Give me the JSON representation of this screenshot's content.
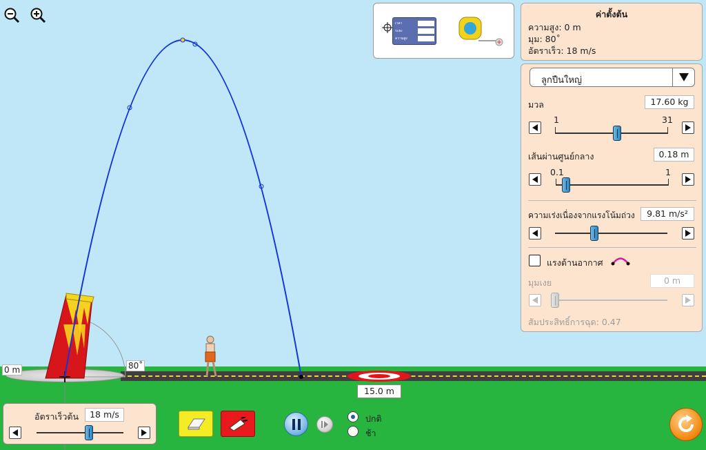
{
  "zoom": {
    "zoom_out_icon": "zoom-out-icon",
    "zoom_in_icon": "zoom-in-icon"
  },
  "tools": {
    "time_tool_labels": [
      "เวลา",
      "ระยะ",
      "ความสูง"
    ]
  },
  "initial_values": {
    "title": "ค่าตั้งต้น",
    "height": "ความสูง: 0 m",
    "angle": "มุม: 80˚",
    "speed": "อัตราเร็ว: 18 m/s"
  },
  "projectile": {
    "selected": "ลูกปืนใหญ่"
  },
  "mass": {
    "label": "มวล",
    "value": "17.60 kg",
    "min": "1",
    "max": "31",
    "level": 0.55
  },
  "diameter": {
    "label": "เส้นผ่านศูนย์กลาง",
    "value": "0.18 m",
    "min": "0.1",
    "max": "1",
    "level": 0.09
  },
  "gravity": {
    "label": "ความเร่งเนื่องจากแรงโน้มถ่วง",
    "value": "9.81 m/s²",
    "level": 0.35
  },
  "air_resistance": {
    "label": "แรงต้านอากาศ",
    "checked": false
  },
  "altitude": {
    "label": "มุมเงย",
    "value": "0 m",
    "level": 0.0
  },
  "drag_coefficient": {
    "text": "สัมประสิทธิ์การฉุด: 0.47"
  },
  "launch_speed": {
    "label": "อัตราเร็วต้น",
    "value": "18 m/s",
    "level": 0.6
  },
  "scene": {
    "height_label": "0 m",
    "angle_label": "80˚",
    "target_distance": "15.0 m"
  },
  "playback": {
    "normal": "ปกติ",
    "slow": "ช้า",
    "selected": "normal"
  },
  "colors": {
    "trajectory": "#1436d6",
    "sky": "#bfe7f8",
    "ground": "#27b53f",
    "panel": "#fde4cf",
    "cannon": "#d6161b"
  }
}
